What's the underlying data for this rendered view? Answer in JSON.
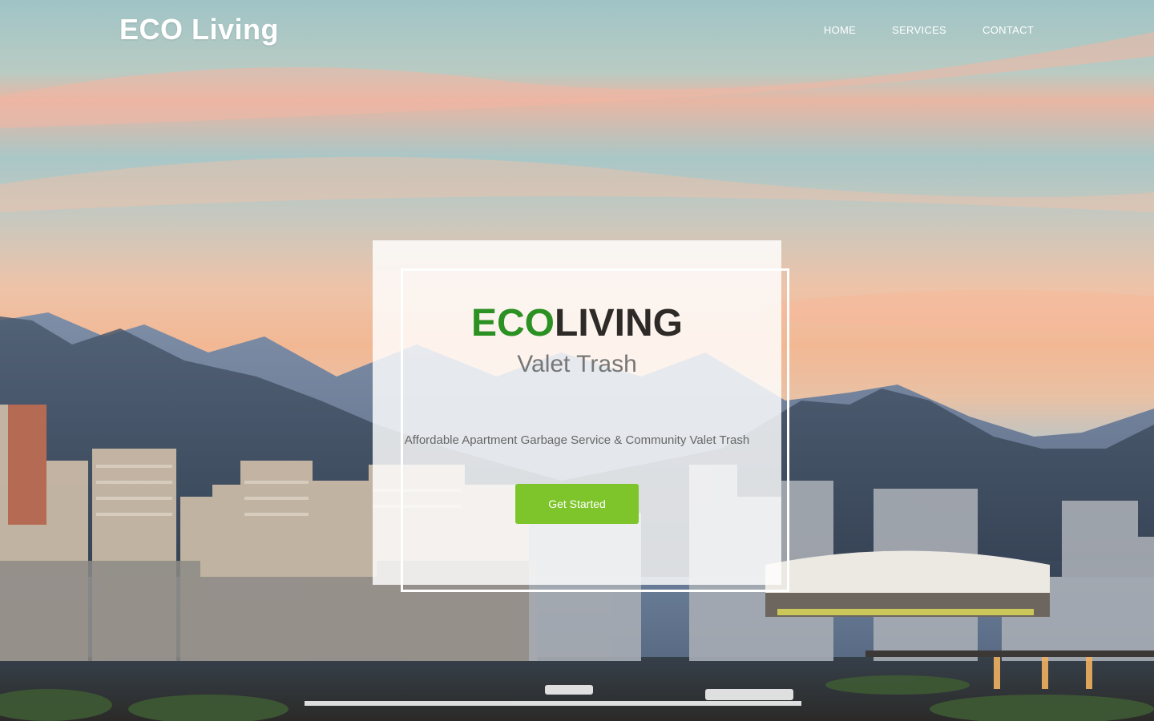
{
  "header": {
    "logo": "ECO Living",
    "nav": [
      "HOME",
      "SERVICES",
      "CONTACT"
    ]
  },
  "hero": {
    "title_part1": "ECO",
    "title_part2": "LIVING",
    "subtitle": "Valet Trash",
    "tagline": "Affordable Apartment Garbage Service & Community Valet Trash",
    "cta_label": "Get Started"
  },
  "colors": {
    "accent_green": "#2a9122",
    "button_green": "#7ec52b",
    "dark_text": "#2d2a27"
  }
}
